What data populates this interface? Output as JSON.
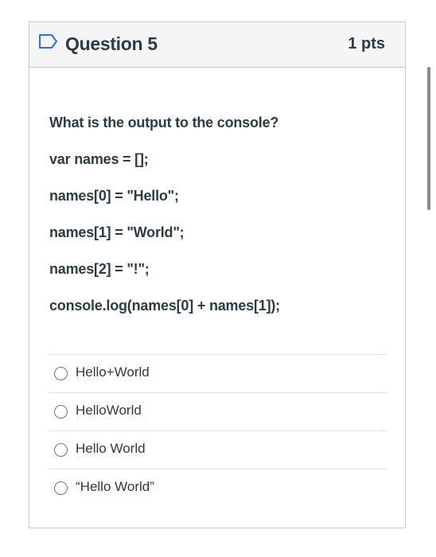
{
  "question": {
    "title": "Question 5",
    "points": "1 pts",
    "flag_icon": "bookmark-flag-icon",
    "prompt_lines": [
      "What is the output to the console?",
      "var names = [];",
      "names[0] = \"Hello\";",
      "names[1] = \"World\";",
      "names[2] = \"!\";",
      "console.log(names[0] + names[1]);"
    ],
    "answers": [
      {
        "label": "Hello+World",
        "selected": false
      },
      {
        "label": "HelloWorld",
        "selected": false
      },
      {
        "label": "Hello World",
        "selected": false
      },
      {
        "label": "“Hello World”",
        "selected": false
      }
    ]
  },
  "colors": {
    "text": "#2d3b45",
    "border": "#c7cdd1",
    "header_bg": "#f5f5f5",
    "flag": "#2d6fdb"
  }
}
